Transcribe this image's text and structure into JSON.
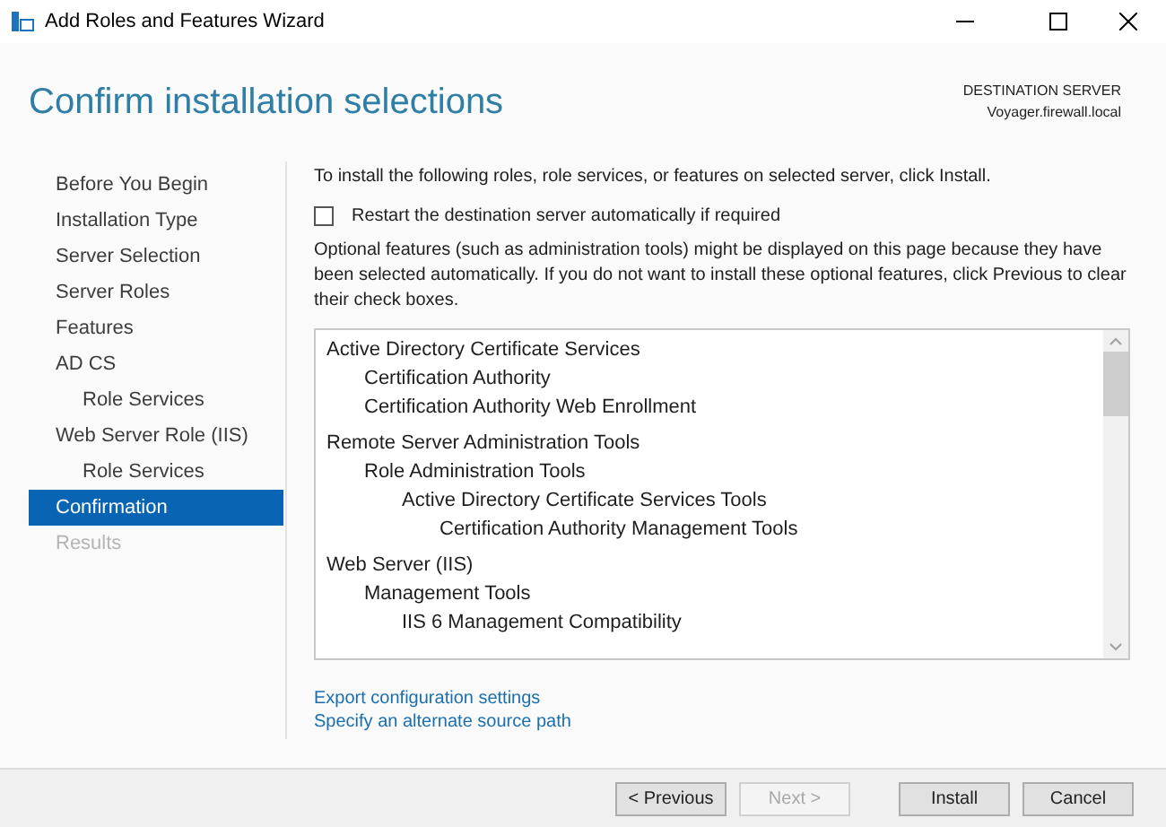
{
  "window": {
    "title": "Add Roles and Features Wizard"
  },
  "header": {
    "title": "Confirm installation selections",
    "destination_label": "DESTINATION SERVER",
    "destination_server": "Voyager.firewall.local"
  },
  "sidebar": {
    "items": [
      {
        "label": "Before You Begin",
        "selected": false,
        "disabled": false
      },
      {
        "label": "Installation Type",
        "selected": false,
        "disabled": false
      },
      {
        "label": "Server Selection",
        "selected": false,
        "disabled": false
      },
      {
        "label": "Server Roles",
        "selected": false,
        "disabled": false
      },
      {
        "label": "Features",
        "selected": false,
        "disabled": false
      },
      {
        "label": "AD CS",
        "selected": false,
        "disabled": false,
        "children": [
          {
            "label": "Role Services",
            "selected": false,
            "disabled": false
          }
        ]
      },
      {
        "label": "Web Server Role (IIS)",
        "selected": false,
        "disabled": false,
        "children": [
          {
            "label": "Role Services",
            "selected": false,
            "disabled": false
          }
        ]
      },
      {
        "label": "Confirmation",
        "selected": true,
        "disabled": false
      },
      {
        "label": "Results",
        "selected": false,
        "disabled": true
      }
    ]
  },
  "intro": "To install the following roles, role services, or features on selected server, click Install.",
  "restart_checkbox": {
    "label": "Restart the destination server automatically if required",
    "checked": false
  },
  "note": "Optional features (such as administration tools) might be displayed on this page because they have been selected automatically. If you do not want to install these optional features, click Previous to clear their check boxes.",
  "selections": [
    {
      "label": "Active Directory Certificate Services",
      "children": [
        {
          "label": "Certification Authority"
        },
        {
          "label": "Certification Authority Web Enrollment"
        }
      ]
    },
    {
      "label": "Remote Server Administration Tools",
      "children": [
        {
          "label": "Role Administration Tools",
          "children": [
            {
              "label": "Active Directory Certificate Services Tools",
              "children": [
                {
                  "label": "Certification Authority Management Tools"
                }
              ]
            }
          ]
        }
      ]
    },
    {
      "label": "Web Server (IIS)",
      "children": [
        {
          "label": "Management Tools",
          "children": [
            {
              "label": "IIS 6 Management Compatibility"
            }
          ]
        }
      ]
    }
  ],
  "links": [
    "Export configuration settings",
    "Specify an alternate source path"
  ],
  "buttons": [
    {
      "label": "< Previous",
      "disabled": false
    },
    {
      "label": "Next >",
      "disabled": true
    },
    {
      "label": "Install",
      "disabled": false
    },
    {
      "label": "Cancel",
      "disabled": false
    }
  ]
}
